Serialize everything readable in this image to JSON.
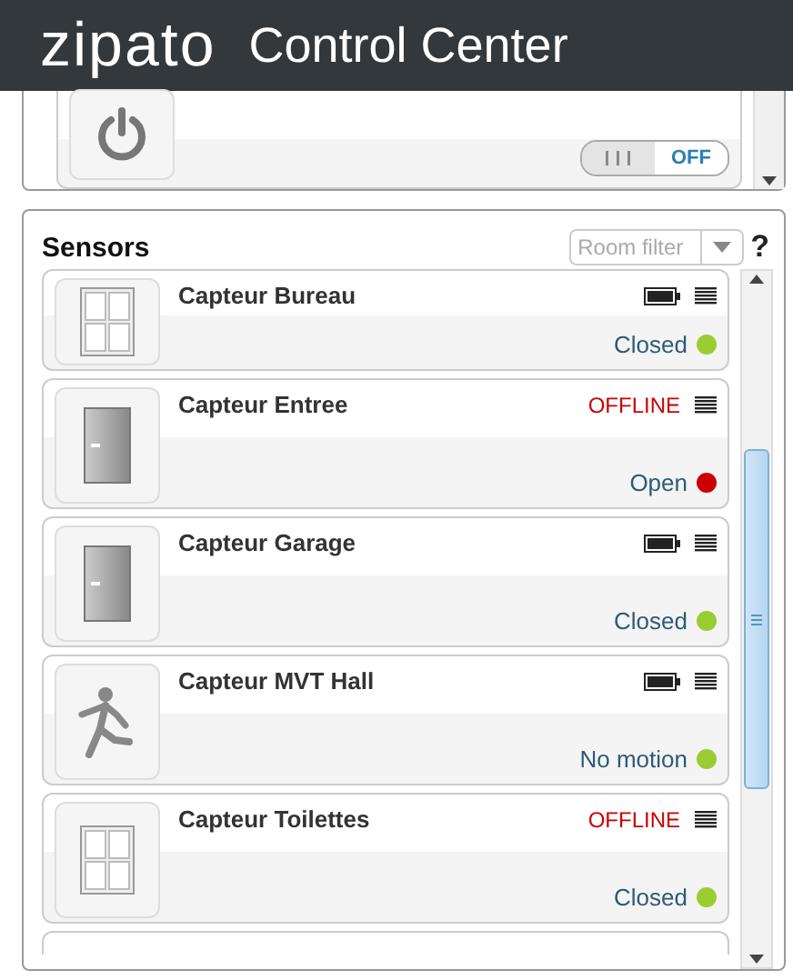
{
  "header": {
    "logo": "zipato",
    "title": "Control Center"
  },
  "switch_panel": {
    "toggle": {
      "label": "OFF",
      "on": false
    }
  },
  "sensors": {
    "title": "Sensors",
    "room_filter": {
      "placeholder": "Room filter"
    },
    "help": "?",
    "items": [
      {
        "name": "Capteur Bureau",
        "kind": "window",
        "offline": false,
        "status": "Closed",
        "color": "#9acd32"
      },
      {
        "name": "Capteur Entree",
        "kind": "door",
        "offline": true,
        "offline_label": "OFFLINE",
        "status": "Open",
        "color": "#cc0000"
      },
      {
        "name": "Capteur Garage",
        "kind": "door",
        "offline": false,
        "status": "Closed",
        "color": "#9acd32"
      },
      {
        "name": "Capteur MVT Hall",
        "kind": "motion",
        "offline": false,
        "status": "No motion",
        "color": "#9acd32"
      },
      {
        "name": "Capteur Toilettes",
        "kind": "window",
        "offline": true,
        "offline_label": "OFFLINE",
        "status": "Closed",
        "color": "#9acd32"
      }
    ]
  }
}
